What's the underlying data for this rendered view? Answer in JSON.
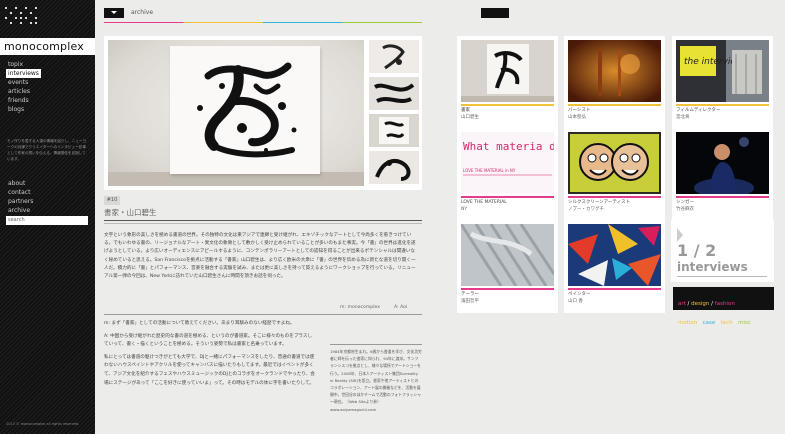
{
  "site": {
    "name": "monocomplex",
    "copyright": "2013 © monocomplex all rights reserved."
  },
  "sidebar": {
    "nav": [
      {
        "label": "topix",
        "active": false
      },
      {
        "label": "interviews",
        "active": true
      },
      {
        "label": "events",
        "active": false
      },
      {
        "label": "articles",
        "active": false
      },
      {
        "label": "friends",
        "active": false
      },
      {
        "label": "blogs",
        "active": false
      }
    ],
    "description": "モノ作りを愛する人達の情報を紹介し、ニューヨークの目線でクリエイターへのインタビュー記事として作家の想いを伝える、情報発信を目指しています。",
    "footer_links": [
      {
        "label": "about"
      },
      {
        "label": "contact"
      },
      {
        "label": "partners"
      },
      {
        "label": "archive"
      }
    ],
    "search_placeholder": "search"
  },
  "header": {
    "section_label": "archive"
  },
  "article": {
    "issue_number": "#10",
    "title": "書家・山口碧生",
    "body": "文字という象形の美しさを極める書道の世界。その独特の文化は東アジアで連綿と受け継がれ、エキゾチックなアートとして今尚多くを惹きつけている。でもいわゆる書の、リージョナルなアート・異文化の象徴として敷かしく受け止められていることが多いのもまた事実。今「書」の世界は進化を遂げようとしている。より広いオーディエンスにアピールするように、コンテンポラリーアートとしての認知を得ることが出来るポテンシャルは間違いなく秘めていると思える。San Franciscoを拠点に活動する「書家」山口碧生は、より広く欧米の大衆に「書」の世界を伝める為に新たな道を切り開く一人だ。積力的に「書」とパフォーマンス、音楽を融合する実験を試み、または更に美しさを持って質えるようにワークショップを行っている。リニューアル第一弾の今回は、New Yorkに訪れていた山口碧生さんに時間を頂きお話を伺った。",
    "credit_interviewer": "m: monocomplex",
    "credit_artist": "A: Aoi",
    "qa": [
      "m: まず「書家」としての活動について教えてください。あまり耳馴みのない経歴ですよね。",
      "A: 中国から受け継がれた歴史的な書の道を極める、というのが書道家。そこに様々のものをプラスしていって、書く・描くということを極める。そういう姿勢で私は書家と名乗っています。",
      "私にとっては書道の駆けつきがとても大学で、DJと一緒にパフォーマンスをしたり、普通の書道では使わないハウスペイントやアクリルを使ってキャンバスに描いたりもしてます。最近ではイベントが多くて、アジア文化を紹介するフェスやハウスミュージックのDJとのコラボをオークランドでやったり、会場にステージがあって「ここを好きに使っていいよ」って。その時はモデルの体に字を書いたりして。"
    ],
    "profile": "1984年京都府生まれ。6歳から書道を学び、文化功労者に師を伝った書家に知られ、94年に渡米。サンフランシスコを拠点とし、様々な場所でアートショーを行う。2008年、日本人アーティスト集団Surreality in Reality (SIR)を設立。書家や他アーティストとのコラボレーション、アート展の開催などを、活動を展開中。世田谷のほかチームで活動のフォトフラッシャー現在。（Web Siteより参）www.aoiyamaguchi.com"
  },
  "cards": [
    {
      "cap1": "書家",
      "cap2": "山口碧生",
      "bar": "#f3c23b"
    },
    {
      "cap1": "バーシスト",
      "cap2": "山本堅弘",
      "bar": "#f3c23b"
    },
    {
      "cap1": "フィルムディレクター",
      "cap2": "宮北将",
      "bar": "#f3c23b"
    },
    {
      "cap1": "LOVE THE MATERIAL",
      "cap2": "NY",
      "bar": "#e63b8c",
      "poster_text": "What materia do you love ?",
      "poster_sub": "LOVE THE MATERIAL in NY"
    },
    {
      "cap1": "シルクスクリーンアーティスト",
      "cap2": "ノブー・カワグチ",
      "bar": "#e63b8c"
    },
    {
      "cap1": "シンガー",
      "cap2": "竹谷麻衣",
      "bar": "#e63b8c"
    },
    {
      "cap1": "テーラー",
      "cap2": "濱田哲平",
      "bar": "#e63b8c"
    },
    {
      "cap1": "ペインター",
      "cap2": "山口 香",
      "bar": "#e63b8c"
    }
  ],
  "pager": {
    "fraction": "1 / 2",
    "label": "interviews"
  },
  "categories": [
    {
      "label": "art",
      "color": "#e63b8c"
    },
    {
      "label": "design",
      "color": "#f3c23b"
    },
    {
      "label": "fashion",
      "color": "#e63b8c"
    },
    {
      "label": "motion",
      "color": "#f3c23b"
    },
    {
      "label": "case",
      "color": "#33b5d8"
    },
    {
      "label": "tech",
      "color": "#f3c23b"
    },
    {
      "label": "misc",
      "color": "#9acd32"
    }
  ],
  "banner_text": "the interview"
}
